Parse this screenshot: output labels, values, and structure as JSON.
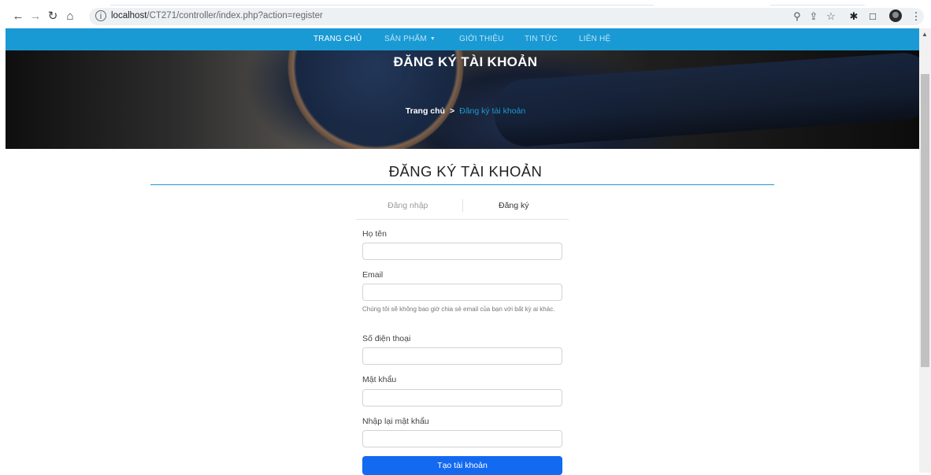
{
  "browser": {
    "url_host": "localhost",
    "url_path": "/CT271/controller/index.php?action=register"
  },
  "nav": {
    "items": [
      {
        "label": "TRANG CHỦ",
        "active": true
      },
      {
        "label": "SẢN PHẨM",
        "dropdown": true
      },
      {
        "label": "GIỚI THIỆU"
      },
      {
        "label": "TIN TỨC"
      },
      {
        "label": "LIÊN HỆ"
      }
    ],
    "accent": "#1a9ad4"
  },
  "hero": {
    "title": "ĐĂNG KÝ TÀI KHOẢN",
    "breadcrumb_home": "Trang chủ",
    "breadcrumb_sep": ">",
    "breadcrumb_current": "Đăng ký tài khoản"
  },
  "main": {
    "title": "ĐĂNG KÝ TÀI KHOẢN",
    "tabs": [
      {
        "label": "Đăng nhập",
        "active": false
      },
      {
        "label": "Đăng ký",
        "active": true
      }
    ],
    "fields": [
      {
        "label": "Họ tên",
        "value": ""
      },
      {
        "label": "Email",
        "value": "",
        "help": "Chúng tôi sẽ không bao giờ chia sẻ email của bạn với bất kỳ ai khác."
      },
      {
        "label": "Số điện thoại",
        "value": ""
      },
      {
        "label": "Mật khẩu",
        "value": ""
      },
      {
        "label": "Nhập lại mật khẩu",
        "value": ""
      }
    ],
    "submit_label": "Tạo tài khoản",
    "submit_color": "#1369f0"
  }
}
